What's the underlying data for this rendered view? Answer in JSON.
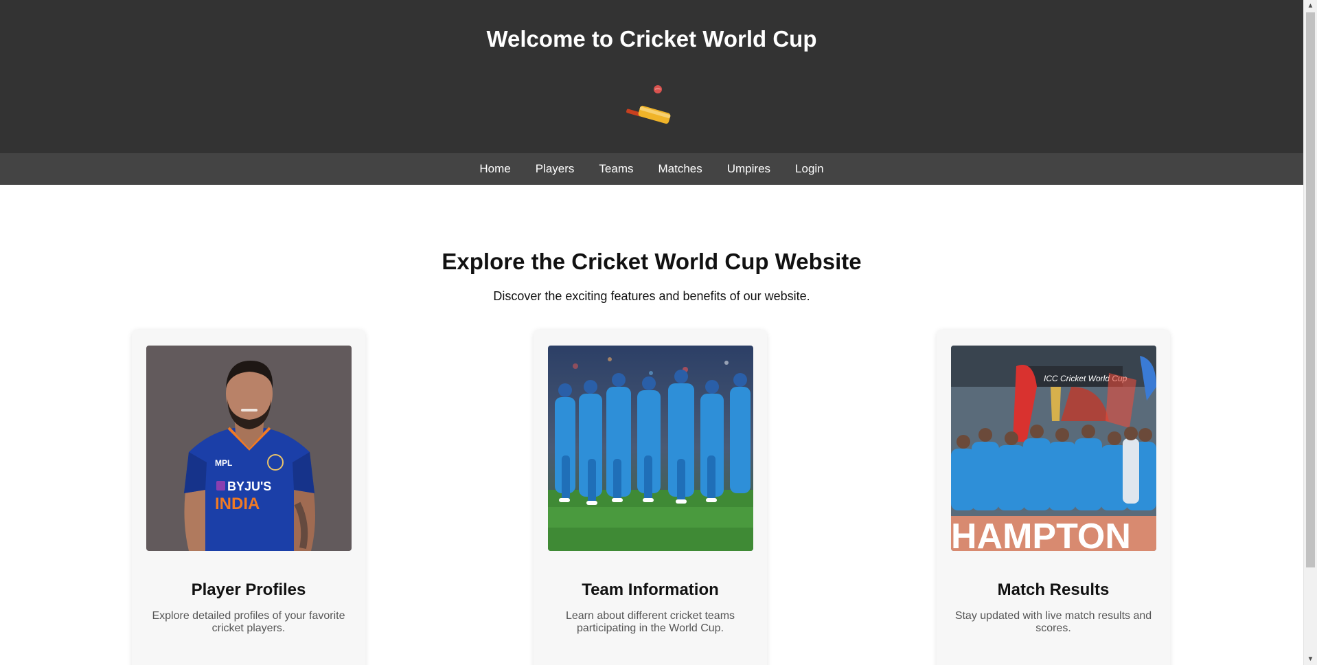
{
  "header": {
    "title": "Welcome to Cricket World Cup",
    "logo_icon": "cricket-bat-ball-icon"
  },
  "nav": {
    "items": [
      {
        "label": "Home"
      },
      {
        "label": "Players"
      },
      {
        "label": "Teams"
      },
      {
        "label": "Matches"
      },
      {
        "label": "Umpires"
      },
      {
        "label": "Login"
      }
    ]
  },
  "hero": {
    "title": "Explore the Cricket World Cup Website",
    "subtitle": "Discover the exciting features and benefits of our website."
  },
  "cards": [
    {
      "title": "Player Profiles",
      "description": "Explore detailed profiles of your favorite cricket players."
    },
    {
      "title": "Team Information",
      "description": "Learn about different cricket teams participating in the World Cup."
    },
    {
      "title": "Match Results",
      "description": "Stay updated with live match results and scores."
    }
  ],
  "images": {
    "card1_jersey": {
      "sponsor": "BYJU'S",
      "team": "INDIA",
      "brand": "MPL"
    },
    "card3_banner": {
      "text": "HAMPTON",
      "board": "ICC Cricket World Cup"
    }
  },
  "colors": {
    "header_bg": "#333333",
    "nav_bg": "#444444",
    "card_bg": "#f7f7f7",
    "jersey_blue": "#1b3fa8",
    "team_blue": "#2e8fd8"
  }
}
